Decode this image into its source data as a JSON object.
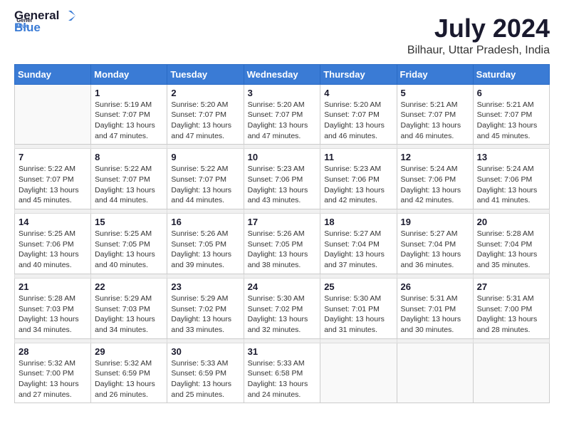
{
  "logo": {
    "general": "General",
    "blue": "Blue"
  },
  "title": "July 2024",
  "location": "Bilhaur, Uttar Pradesh, India",
  "weekdays": [
    "Sunday",
    "Monday",
    "Tuesday",
    "Wednesday",
    "Thursday",
    "Friday",
    "Saturday"
  ],
  "weeks": [
    [
      {
        "day": "",
        "info": ""
      },
      {
        "day": "1",
        "info": "Sunrise: 5:19 AM\nSunset: 7:07 PM\nDaylight: 13 hours\nand 47 minutes."
      },
      {
        "day": "2",
        "info": "Sunrise: 5:20 AM\nSunset: 7:07 PM\nDaylight: 13 hours\nand 47 minutes."
      },
      {
        "day": "3",
        "info": "Sunrise: 5:20 AM\nSunset: 7:07 PM\nDaylight: 13 hours\nand 47 minutes."
      },
      {
        "day": "4",
        "info": "Sunrise: 5:20 AM\nSunset: 7:07 PM\nDaylight: 13 hours\nand 46 minutes."
      },
      {
        "day": "5",
        "info": "Sunrise: 5:21 AM\nSunset: 7:07 PM\nDaylight: 13 hours\nand 46 minutes."
      },
      {
        "day": "6",
        "info": "Sunrise: 5:21 AM\nSunset: 7:07 PM\nDaylight: 13 hours\nand 45 minutes."
      }
    ],
    [
      {
        "day": "7",
        "info": "Sunrise: 5:22 AM\nSunset: 7:07 PM\nDaylight: 13 hours\nand 45 minutes."
      },
      {
        "day": "8",
        "info": "Sunrise: 5:22 AM\nSunset: 7:07 PM\nDaylight: 13 hours\nand 44 minutes."
      },
      {
        "day": "9",
        "info": "Sunrise: 5:22 AM\nSunset: 7:07 PM\nDaylight: 13 hours\nand 44 minutes."
      },
      {
        "day": "10",
        "info": "Sunrise: 5:23 AM\nSunset: 7:06 PM\nDaylight: 13 hours\nand 43 minutes."
      },
      {
        "day": "11",
        "info": "Sunrise: 5:23 AM\nSunset: 7:06 PM\nDaylight: 13 hours\nand 42 minutes."
      },
      {
        "day": "12",
        "info": "Sunrise: 5:24 AM\nSunset: 7:06 PM\nDaylight: 13 hours\nand 42 minutes."
      },
      {
        "day": "13",
        "info": "Sunrise: 5:24 AM\nSunset: 7:06 PM\nDaylight: 13 hours\nand 41 minutes."
      }
    ],
    [
      {
        "day": "14",
        "info": "Sunrise: 5:25 AM\nSunset: 7:06 PM\nDaylight: 13 hours\nand 40 minutes."
      },
      {
        "day": "15",
        "info": "Sunrise: 5:25 AM\nSunset: 7:05 PM\nDaylight: 13 hours\nand 40 minutes."
      },
      {
        "day": "16",
        "info": "Sunrise: 5:26 AM\nSunset: 7:05 PM\nDaylight: 13 hours\nand 39 minutes."
      },
      {
        "day": "17",
        "info": "Sunrise: 5:26 AM\nSunset: 7:05 PM\nDaylight: 13 hours\nand 38 minutes."
      },
      {
        "day": "18",
        "info": "Sunrise: 5:27 AM\nSunset: 7:04 PM\nDaylight: 13 hours\nand 37 minutes."
      },
      {
        "day": "19",
        "info": "Sunrise: 5:27 AM\nSunset: 7:04 PM\nDaylight: 13 hours\nand 36 minutes."
      },
      {
        "day": "20",
        "info": "Sunrise: 5:28 AM\nSunset: 7:04 PM\nDaylight: 13 hours\nand 35 minutes."
      }
    ],
    [
      {
        "day": "21",
        "info": "Sunrise: 5:28 AM\nSunset: 7:03 PM\nDaylight: 13 hours\nand 34 minutes."
      },
      {
        "day": "22",
        "info": "Sunrise: 5:29 AM\nSunset: 7:03 PM\nDaylight: 13 hours\nand 34 minutes."
      },
      {
        "day": "23",
        "info": "Sunrise: 5:29 AM\nSunset: 7:02 PM\nDaylight: 13 hours\nand 33 minutes."
      },
      {
        "day": "24",
        "info": "Sunrise: 5:30 AM\nSunset: 7:02 PM\nDaylight: 13 hours\nand 32 minutes."
      },
      {
        "day": "25",
        "info": "Sunrise: 5:30 AM\nSunset: 7:01 PM\nDaylight: 13 hours\nand 31 minutes."
      },
      {
        "day": "26",
        "info": "Sunrise: 5:31 AM\nSunset: 7:01 PM\nDaylight: 13 hours\nand 30 minutes."
      },
      {
        "day": "27",
        "info": "Sunrise: 5:31 AM\nSunset: 7:00 PM\nDaylight: 13 hours\nand 28 minutes."
      }
    ],
    [
      {
        "day": "28",
        "info": "Sunrise: 5:32 AM\nSunset: 7:00 PM\nDaylight: 13 hours\nand 27 minutes."
      },
      {
        "day": "29",
        "info": "Sunrise: 5:32 AM\nSunset: 6:59 PM\nDaylight: 13 hours\nand 26 minutes."
      },
      {
        "day": "30",
        "info": "Sunrise: 5:33 AM\nSunset: 6:59 PM\nDaylight: 13 hours\nand 25 minutes."
      },
      {
        "day": "31",
        "info": "Sunrise: 5:33 AM\nSunset: 6:58 PM\nDaylight: 13 hours\nand 24 minutes."
      },
      {
        "day": "",
        "info": ""
      },
      {
        "day": "",
        "info": ""
      },
      {
        "day": "",
        "info": ""
      }
    ]
  ]
}
